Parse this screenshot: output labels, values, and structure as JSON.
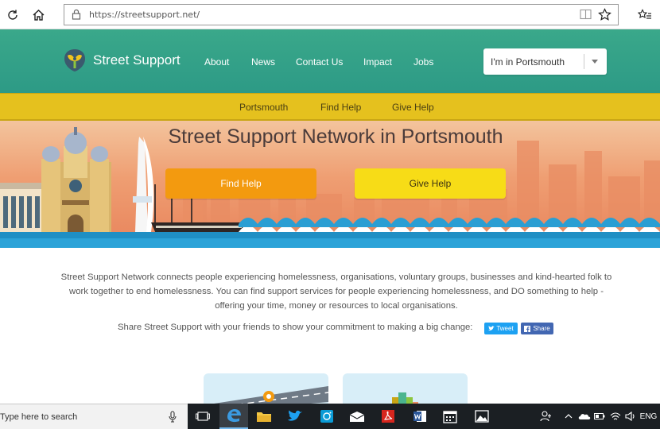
{
  "browser": {
    "url": "https://streetsupport.net/"
  },
  "header": {
    "brand": "Street Support",
    "nav": [
      "About",
      "News",
      "Contact Us",
      "Impact",
      "Jobs"
    ],
    "location_select": "I'm in Portsmouth"
  },
  "subnav": [
    "Portsmouth",
    "Find Help",
    "Give Help"
  ],
  "hero": {
    "title": "Street Support Network in Portsmouth",
    "find_help": "Find Help",
    "give_help": "Give Help"
  },
  "content": {
    "intro": "Street Support Network connects people experiencing homelessness, organisations, voluntary groups, businesses and kind-hearted folk to work together to end homelessness. You can find support services for people experiencing homelessness, and DO something to help - offering your time, money or resources to local organisations.",
    "share_text": "Share Street Support with your friends to show your commitment to making a big change:",
    "tweet": "Tweet",
    "share": "Share"
  },
  "taskbar": {
    "search_placeholder": "Type here to search",
    "language": "ENG"
  },
  "colors": {
    "header": "#2d9a86",
    "subnav": "#e5c11e",
    "find_help_btn": "#f39a0f",
    "give_help_btn": "#f7dc17",
    "sea": "#1f8fc4"
  }
}
